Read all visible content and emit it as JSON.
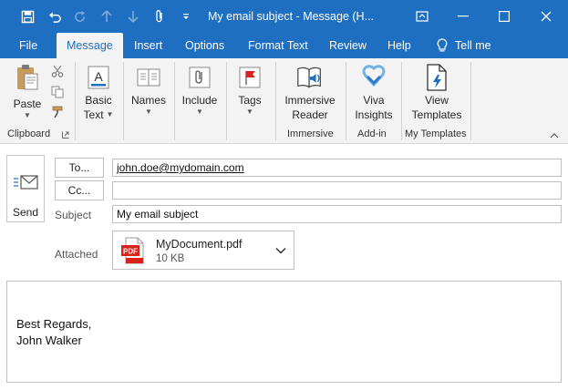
{
  "window": {
    "title": "My email subject  -  Message (H...",
    "qat": {
      "save_icon": "save-icon",
      "undo_icon": "undo-icon",
      "redo_icon": "redo-icon",
      "up_icon": "arrow-up-icon",
      "down_icon": "arrow-down-icon",
      "attach_icon": "paperclip-icon",
      "customize_icon": "customize-qat-icon"
    },
    "controls": [
      "restore-ribbon-icon",
      "minimize-icon",
      "maximize-icon",
      "close-icon"
    ]
  },
  "ribbon": {
    "tabs": [
      {
        "label": "File"
      },
      {
        "label": "Message",
        "active": true
      },
      {
        "label": "Insert"
      },
      {
        "label": "Options"
      },
      {
        "label": "Format Text"
      },
      {
        "label": "Review"
      },
      {
        "label": "Help"
      },
      {
        "label": "Tell me"
      }
    ],
    "groups": {
      "clipboard": {
        "label": "Clipboard",
        "paste_label": "Paste"
      },
      "basic_text": {
        "label_line1": "Basic",
        "label_line2": "Text"
      },
      "names": {
        "label": "Names"
      },
      "include": {
        "label": "Include"
      },
      "tags": {
        "label": "Tags"
      },
      "immersive": {
        "label": "Immersive",
        "button_line1": "Immersive",
        "button_line2": "Reader"
      },
      "addin": {
        "label": "Add-in",
        "button_line1": "Viva",
        "button_line2": "Insights"
      },
      "templates": {
        "label": "My Templates",
        "button_line1": "View",
        "button_line2": "Templates"
      }
    }
  },
  "compose": {
    "send_label": "Send",
    "to_button": "To...",
    "cc_button": "Cc...",
    "to_value": "john.doe@mydomain.com",
    "cc_value": "",
    "subject_label": "Subject",
    "subject_value": "My email subject",
    "attached_label": "Attached",
    "attachment": {
      "name": "MyDocument.pdf",
      "size": "10 KB",
      "icon_text": "PDF"
    },
    "body_line1": "Best Regards,",
    "body_line2": "John Walker"
  },
  "colors": {
    "accent": "#1e6fc1",
    "ribbon_bg": "#f3f3f3",
    "pdf_red": "#d9221c"
  }
}
